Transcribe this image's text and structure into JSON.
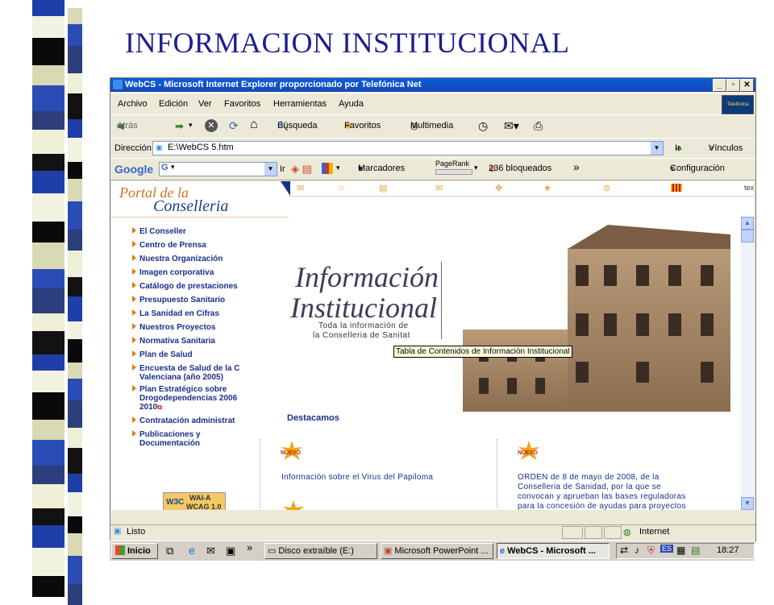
{
  "slide": {
    "title": "INFORMACION INSTITUCIONAL"
  },
  "window": {
    "title": "WebCS - Microsoft Internet Explorer proporcionado por Telefónica Net"
  },
  "menubar": {
    "items": [
      "Archivo",
      "Edición",
      "Ver",
      "Favoritos",
      "Herramientas",
      "Ayuda"
    ]
  },
  "toolbar": {
    "back": "Atrás",
    "search": "Búsqueda",
    "favorites": "Favoritos",
    "multimedia": "Multimedia"
  },
  "addressbar": {
    "label": "Dirección",
    "value": "E:\\WebCS 5.htm",
    "go": "Ir",
    "links": "Vínculos"
  },
  "googlebar": {
    "google": "Google",
    "go": "Ir",
    "bookmarks": "Marcadores",
    "pagerank": "PageRank",
    "blocked": "236 bloqueados",
    "settings": "Configuración"
  },
  "page": {
    "logo_line1": "Portal de la",
    "logo_line2": "Conselleria",
    "topnav_extra": "tex",
    "nav": [
      "El Conseller",
      "Centro de Prensa",
      "Nuestra Organización",
      "Imagen corporativa",
      "Catálogo de prestaciones",
      "Presupuesto Sanitario",
      "La Sanidad en Cifras",
      "Nuestros Proyectos",
      "Normativa Sanitaria",
      "Plan de Salud",
      "Encuesta de Salud de la C",
      "Valenciana (año 2005)",
      "Plan Estratégico sobre",
      "Drogodependencias 2006",
      "2010",
      "Contratación administrat",
      "Publicaciones y",
      "Documentación"
    ],
    "heading_line1": "Información",
    "heading_line2": "Institucional",
    "subtitle_line1": "Toda la información de",
    "subtitle_line2": "la Conselleria de Sanitat",
    "tooltip": "Tabla de Contenidos de Información Institucional",
    "destacamos": "Destacamos",
    "badge": "NUEVO",
    "news1": "Información sobre el Virus del Papiloma",
    "news2_lines": [
      "ORDEN de 8 de mayo de 2008, de la",
      "Conselleria de Sanidad, por la que se",
      "convocan y aprueban las bases reguladoras",
      "para la concesión de ayudas para proyectos"
    ],
    "wai_line1": "WAI-A",
    "wai_line2": "WCAG 1.0",
    "w3c": "W3C"
  },
  "status": {
    "text": "Listo",
    "zone": "Internet"
  },
  "taskbar": {
    "start": "Inicio",
    "tasks": [
      "Disco extraíble (E:)",
      "Microsoft PowerPoint ...",
      "WebCS - Microsoft ..."
    ],
    "lang": "ES",
    "clock": "18:27"
  }
}
